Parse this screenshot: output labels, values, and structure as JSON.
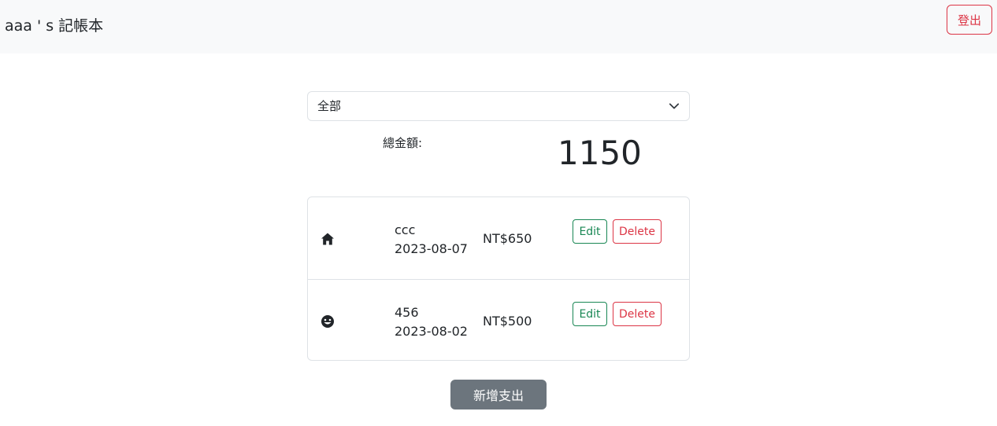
{
  "navbar": {
    "brand": "aaa ' s 記帳本",
    "logout_label": "登出"
  },
  "filter": {
    "selected": "全部",
    "icon": "chevron-down-icon"
  },
  "summary": {
    "label": "總金額:",
    "value": "1150"
  },
  "records": [
    {
      "icon": "house-icon",
      "name": "ccc",
      "date": "2023-08-07",
      "amount": "NT$650",
      "edit_label": "Edit",
      "delete_label": "Delete"
    },
    {
      "icon": "smile-face-icon",
      "name": "456",
      "date": "2023-08-02",
      "amount": "NT$500",
      "edit_label": "Edit",
      "delete_label": "Delete"
    }
  ],
  "actions": {
    "add_label": "新增支出"
  },
  "colors": {
    "danger": "#dc3545",
    "success": "#198754",
    "secondary": "#6c757d",
    "navbar_bg": "#f8f9fa"
  }
}
